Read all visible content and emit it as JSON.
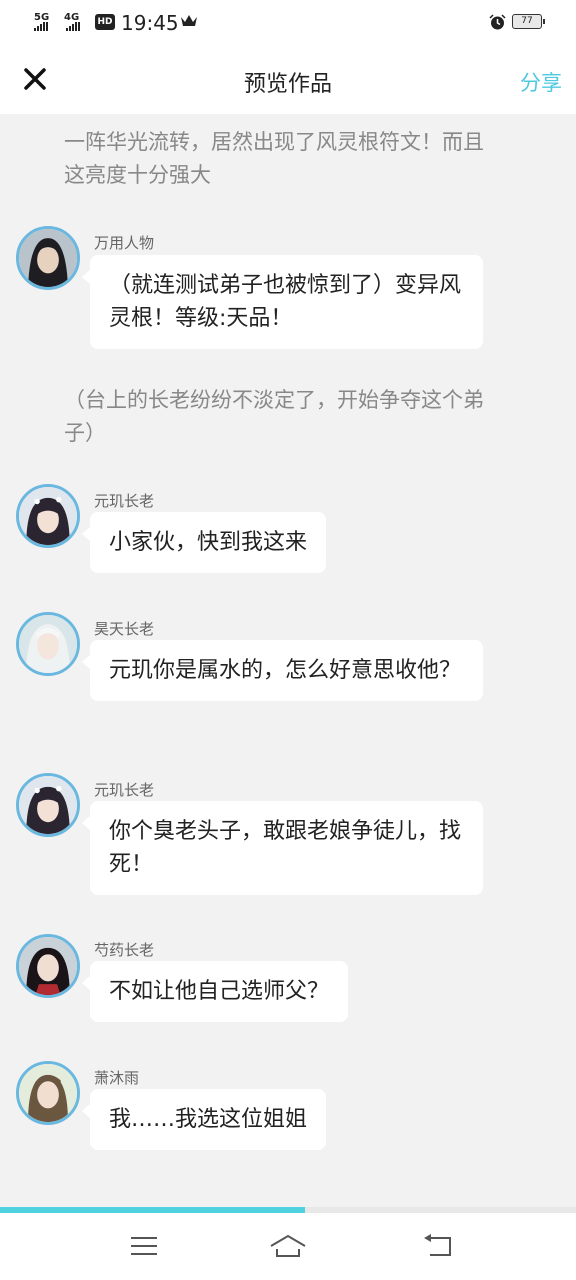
{
  "status_bar": {
    "net1": "5G",
    "net2": "4G",
    "hd": "HD",
    "time": "19:45",
    "crown_icon": "crown-icon",
    "alarm_icon": "alarm-icon",
    "battery": "77"
  },
  "header": {
    "close_icon": "close-icon",
    "title": "预览作品",
    "share": "分享"
  },
  "story": {
    "narration_1": "一阵华光流转，居然出现了风灵根符文！而且这亮度十分强大",
    "narration_2": "（台上的长老纷纷不淡定了，开始争夺这个弟子）",
    "messages": [
      {
        "speaker": "万用人物",
        "text": "（就连测试弟子也被惊到了）变异风灵根！等级:天品！"
      },
      {
        "speaker": "元玑长老",
        "text": "小家伙，快到我这来"
      },
      {
        "speaker": "昊天长老",
        "text": "元玑你是属水的，怎么好意思收他？"
      },
      {
        "speaker": "元玑长老",
        "text": "你个臭老头子，敢跟老娘争徒儿，找死！"
      },
      {
        "speaker": "芍药长老",
        "text": "不如让他自己选师父？"
      },
      {
        "speaker": "萧沐雨",
        "text": "我……我选这位姐姐"
      }
    ]
  },
  "reading_progress": 0.53,
  "colors": {
    "accent": "#4fc9e2",
    "avatar_ring": "#6ab8df",
    "background": "#f2f2f2"
  },
  "nav_bar": {
    "menu_icon": "menu-icon",
    "home_icon": "home-icon",
    "back_icon": "back-icon"
  }
}
